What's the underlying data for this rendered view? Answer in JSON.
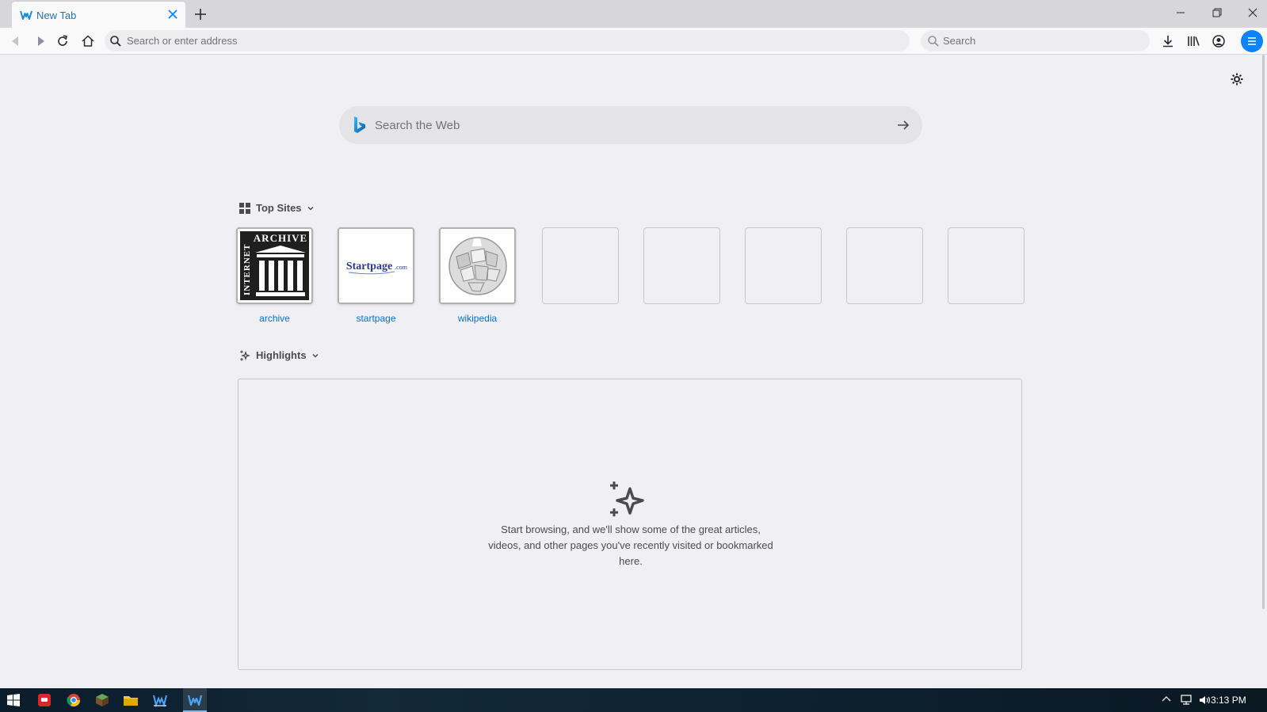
{
  "tab": {
    "title": "New Tab"
  },
  "toolbar": {
    "url_placeholder": "Search or enter address",
    "search_placeholder": "Search"
  },
  "newtab": {
    "web_search_placeholder": "Search the Web",
    "top_sites_title": "Top Sites",
    "top_sites": [
      {
        "label": "archive"
      },
      {
        "label": "startpage"
      },
      {
        "label": "wikipedia"
      }
    ],
    "archive_logo_text": {
      "top": "ARCHIVE",
      "side": "INTERNET"
    },
    "startpage_logo_text": {
      "main": "Startpage",
      "suffix": ".com"
    },
    "highlights_title": "Highlights",
    "highlights_empty": "Start browsing, and we'll show some of the great articles, videos, and other pages you've recently visited or bookmarked here."
  },
  "taskbar": {
    "clock": "3:13 PM"
  },
  "colors": {
    "accent": "#0a84ff",
    "link": "#0a6fc7",
    "tab_title": "#2374ae",
    "page_bg": "#f0f0f4"
  }
}
